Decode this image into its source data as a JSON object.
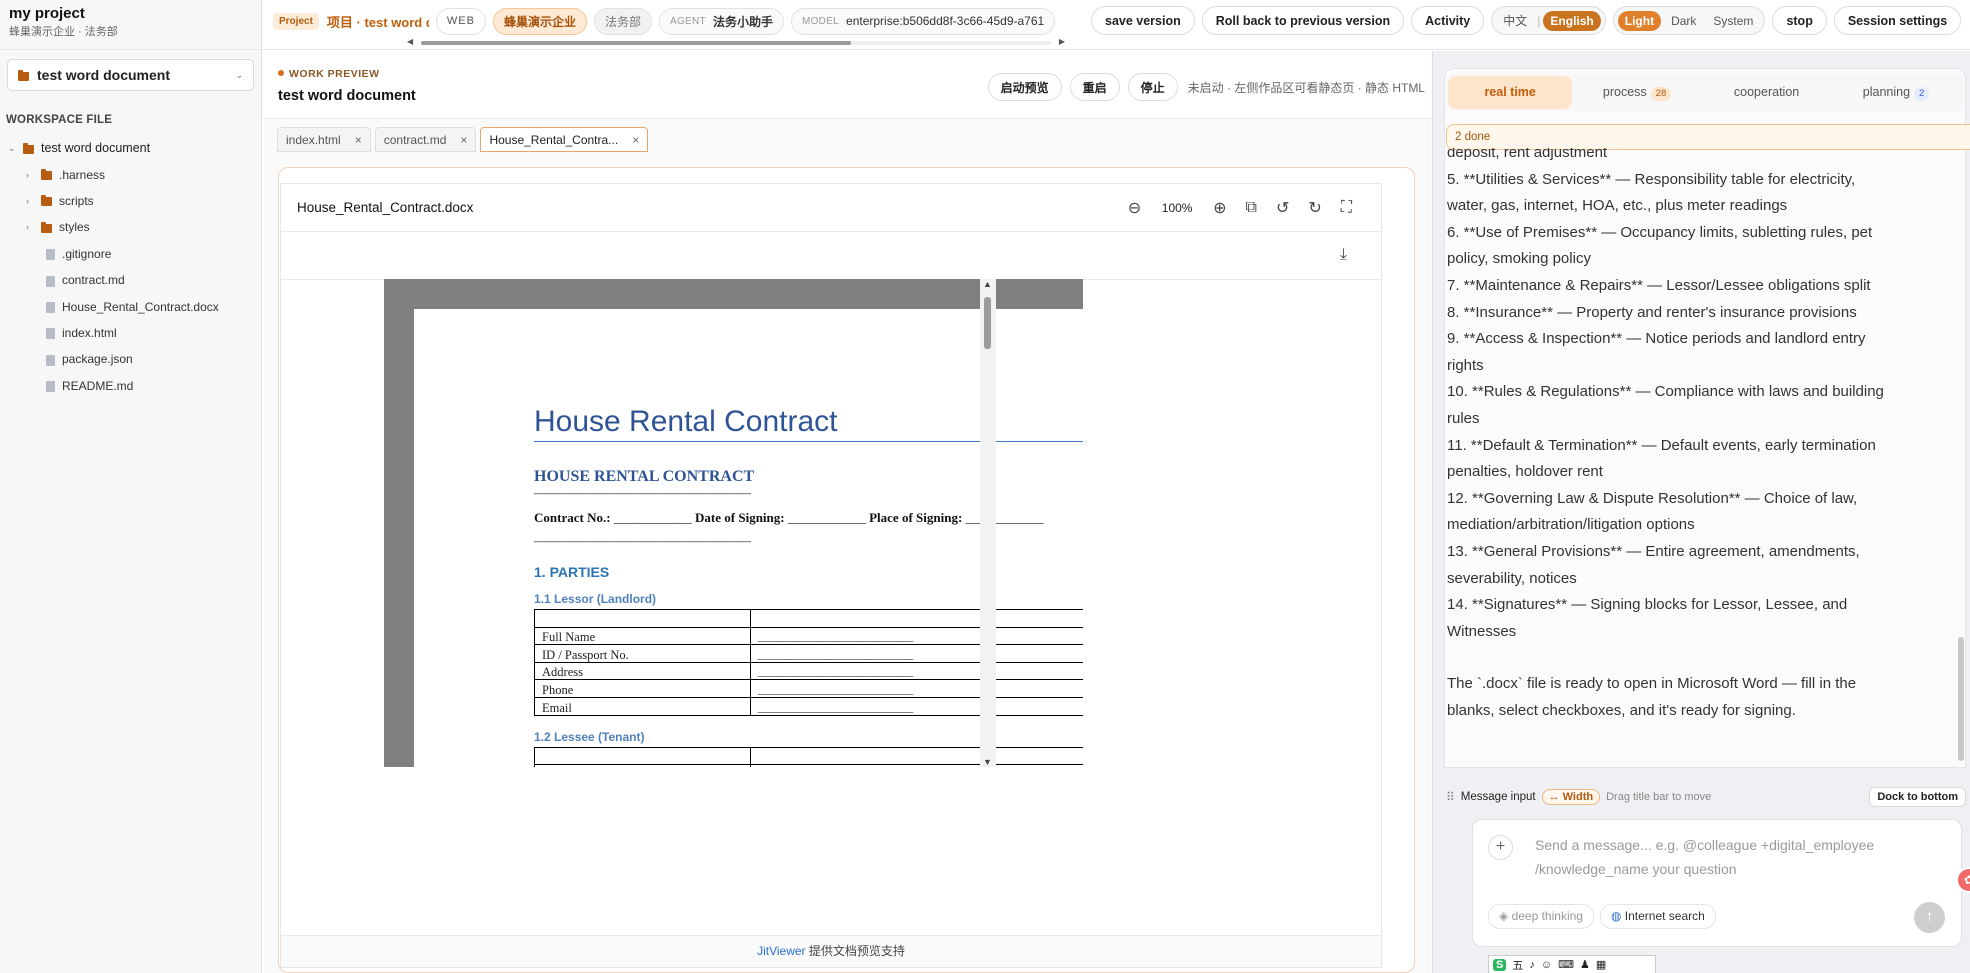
{
  "sidebar": {
    "project_title": "my project",
    "project_subtitle": "蜂巢演示企业 · 法务部",
    "selected_workspace": "test word document",
    "section_label": "WORKSPACE FILE",
    "tree": [
      {
        "name": "test word document",
        "type": "folder",
        "expanded": true
      },
      {
        "name": ".harness",
        "type": "folder"
      },
      {
        "name": "scripts",
        "type": "folder"
      },
      {
        "name": "styles",
        "type": "folder"
      },
      {
        "name": ".gitignore",
        "type": "file"
      },
      {
        "name": "contract.md",
        "type": "file"
      },
      {
        "name": "House_Rental_Contract.docx",
        "type": "file"
      },
      {
        "name": "index.html",
        "type": "file"
      },
      {
        "name": "package.json",
        "type": "file"
      },
      {
        "name": "README.md",
        "type": "file"
      }
    ]
  },
  "topbar": {
    "project_badge": "Project",
    "project_title": "项目 · test word document",
    "web_chip": "WEB",
    "org_chip": "蜂巢演示企业",
    "dept_chip": "法务部",
    "agent_key": "AGENT",
    "agent_value": "法务小助手",
    "model_key": "MODEL",
    "model_value": "enterprise:b506dd8f-3c66-45d9-a761",
    "save_version": "save version",
    "rollback": "Roll back to previous version",
    "activity": "Activity",
    "lang_zh": "中文",
    "lang_en": "English",
    "theme_light": "Light",
    "theme_dark": "Dark",
    "theme_system": "System",
    "stop": "stop",
    "session_settings": "Session settings"
  },
  "work": {
    "label": "WORK PREVIEW",
    "title": "test word document",
    "start_preview": "启动预览",
    "restart": "重启",
    "stop": "停止",
    "status": "未启动 · 左侧作品区可看静态页 · 静态 HTML",
    "tabs": [
      {
        "label": "index.html",
        "active": false
      },
      {
        "label": "contract.md",
        "active": false
      },
      {
        "label": "House_Rental_Contra...",
        "active": true
      }
    ]
  },
  "viewer": {
    "filename": "House_Rental_Contract.docx",
    "zoom": "100%",
    "footer_brand": "JitViewer",
    "footer_text": "提供文档预览支持"
  },
  "document": {
    "title": "House Rental Contract",
    "heading": "HOUSE RENTAL CONTRACT",
    "rule": "——————————————————",
    "contract_no_label": "Contract No.:",
    "date_label": "Date of Signing:",
    "place_label": "Place of Signing:",
    "blank": "____________",
    "section1": "1. PARTIES",
    "lessor_heading": "1.1 Lessor (Landlord)",
    "lessee_heading": "1.2 Lessee (Tenant)",
    "fields": [
      "Full Name",
      "ID / Passport No.",
      "Address",
      "Phone",
      "Email"
    ],
    "field_blank": "_______________________________"
  },
  "chat": {
    "tabs": [
      {
        "label": "real time",
        "active": true
      },
      {
        "label": "process",
        "badge": "28"
      },
      {
        "label": "cooperation"
      },
      {
        "label": "planning",
        "badge": "2"
      }
    ],
    "done_label": "2 done",
    "lines": [
      "deposit, rent adjustment",
      "5. **Utilities & Services** — Responsibility table for electricity,",
      "water, gas, internet, HOA, etc., plus meter readings",
      "6. **Use of Premises** — Occupancy limits, subletting rules, pet",
      "policy, smoking policy",
      "7. **Maintenance & Repairs** — Lessor/Lessee obligations split",
      "8. **Insurance** — Property and renter's insurance provisions",
      "9. **Access & Inspection** — Notice periods and landlord entry",
      "rights",
      "10. **Rules & Regulations** — Compliance with laws and building",
      "rules",
      "11. **Default & Termination** — Default events, early termination",
      "penalties, holdover rent",
      "12. **Governing Law & Dispute Resolution** — Choice of law,",
      "mediation/arbitration/litigation options",
      "13. **General Provisions** — Entire agreement, amendments,",
      "severability, notices",
      "14. **Signatures** — Signing blocks for Lessor, Lessee, and",
      "Witnesses",
      "",
      "The `.docx` file is ready to open in Microsoft Word — fill in the",
      "blanks, select checkboxes, and it's ready for signing."
    ],
    "input_title": "Message input",
    "width_btn": "↔ Width",
    "drag_hint": "Drag title bar to move",
    "dock_btn": "Dock to bottom",
    "placeholder": "Send a message... e.g. @colleague +digital_employee /knowledge_name your question",
    "deep_thinking": "deep thinking",
    "internet_search": "Internet search"
  },
  "colors": {
    "accent": "#c9731e",
    "doc_blue": "#2f5496",
    "link_blue": "#2a6fd6"
  }
}
